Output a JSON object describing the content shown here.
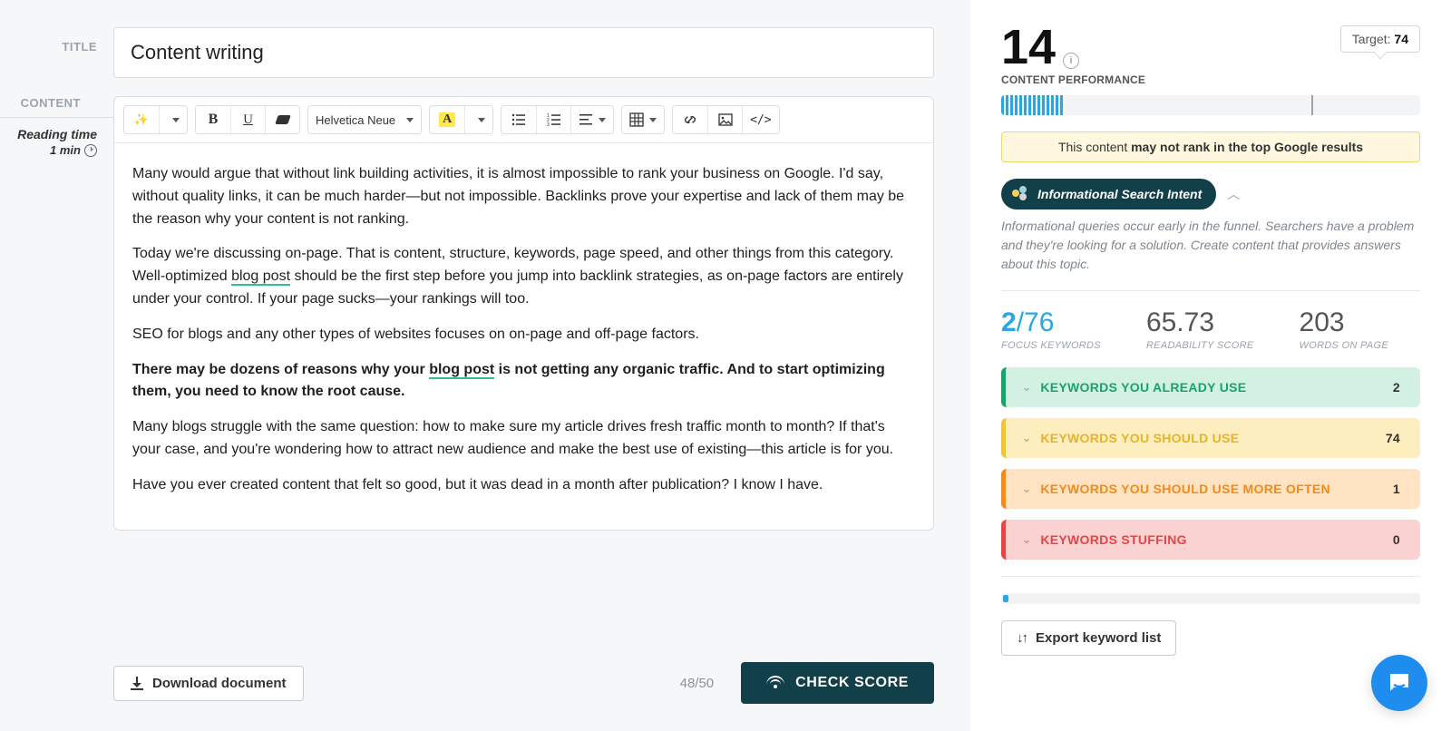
{
  "labels": {
    "title": "TITLE",
    "content": "CONTENT",
    "readingTime": "Reading time",
    "readingValue": "1 min"
  },
  "title": "Content writing",
  "toolbar": {
    "font": "Helvetica Neue",
    "code": "</>"
  },
  "body": {
    "p1": "Many would argue that without link building activities, it is almost impossible to rank your business on Google. I'd say, without quality links, it can be much harder—but not impossible. Backlinks prove your expertise and lack of them may be the reason why your content is not ranking.",
    "p2a": "Today we're discussing on-page. That is content, structure, keywords, page speed, and other things from this category. Well-optimized ",
    "p2kw": "blog post",
    "p2b": " should be the first step before you jump into backlink strategies, as on-page factors are entirely under your control. If your page sucks—your rankings will too.",
    "p3": "SEO for blogs and any other types of websites focuses on on-page and off-page factors.",
    "p4a": "There may be dozens of reasons why your ",
    "p4kw": "blog post",
    "p4b": " is not getting any organic traffic. And to start optimizing them, you need to know the root cause.",
    "p5": "Many blogs struggle with the same question: how to make sure my article drives fresh traffic month to month? If that's your case, and you're wondering how to attract new audience and make the best use of existing—this article is for you.",
    "p6": "Have you ever created content that felt so good, but it was dead in a month after publication? I know I have."
  },
  "bottom": {
    "download": "Download document",
    "counter": "48/50",
    "check": "CHECK SCORE"
  },
  "right": {
    "score": "14",
    "perfLabel": "CONTENT PERFORMANCE",
    "targetLabel": "Target: ",
    "targetValue": "74",
    "alertA": "This content ",
    "alertB": "may not rank in the top Google results",
    "intent": "Informational Search Intent",
    "intentDesc": "Informational queries occur early in the funnel. Searchers have a problem and they're looking for a solution. Create content that provides answers about this topic.",
    "stats": {
      "focusHave": "2",
      "focusTotal": "/76",
      "focusLabel": "FOCUS KEYWORDS",
      "read": "65.73",
      "readLabel": "READABILITY SCORE",
      "words": "203",
      "wordsLabel": "WORDS ON PAGE"
    },
    "cards": {
      "use": {
        "label": "KEYWORDS YOU ALREADY USE",
        "count": "2"
      },
      "should": {
        "label": "KEYWORDS YOU SHOULD USE",
        "count": "74"
      },
      "more": {
        "label": "KEYWORDS YOU SHOULD USE MORE OFTEN",
        "count": "1"
      },
      "stuff": {
        "label": "KEYWORDS STUFFING",
        "count": "0"
      }
    },
    "export": "Export keyword list"
  }
}
